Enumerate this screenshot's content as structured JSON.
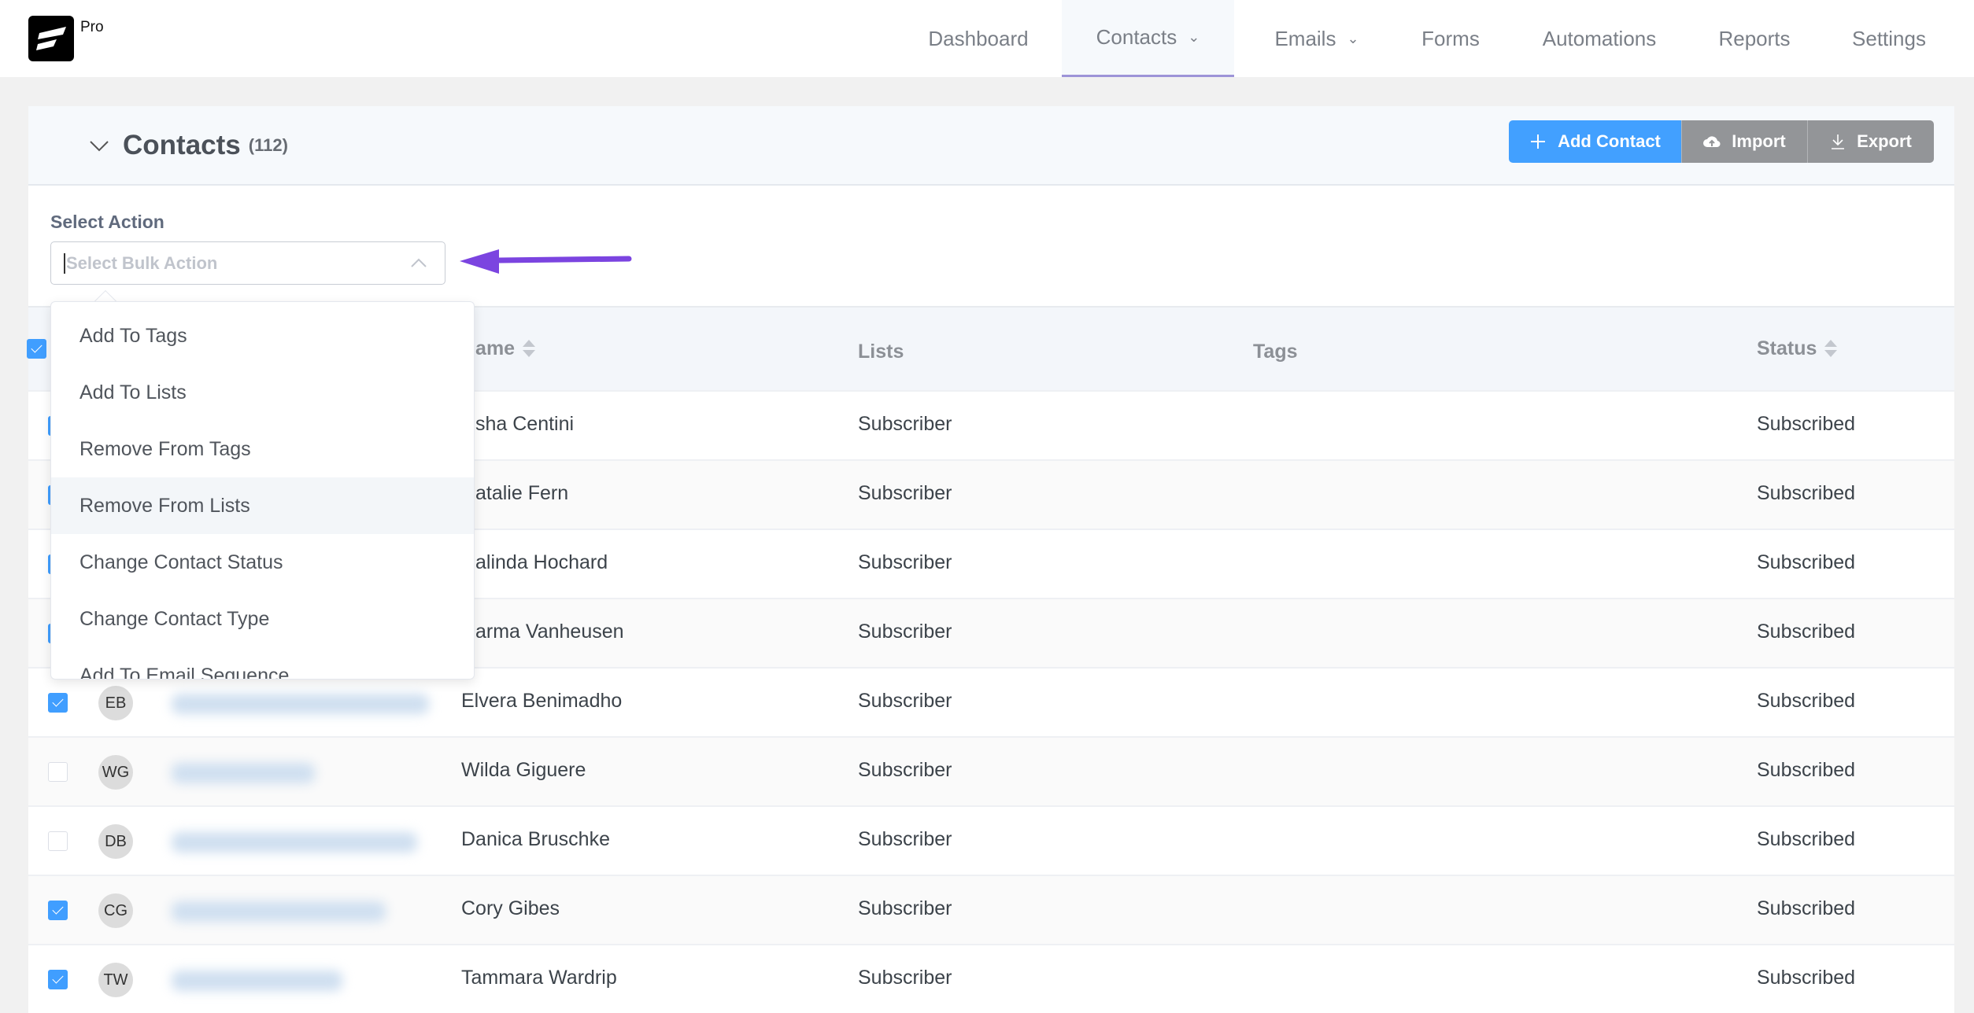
{
  "app": {
    "badge": "Pro",
    "logo_icon": "fluentcrm-logo"
  },
  "nav": [
    {
      "label": "Dashboard"
    },
    {
      "label": "Contacts",
      "has_dropdown": true,
      "active": true
    },
    {
      "label": "Emails",
      "has_dropdown": true
    },
    {
      "label": "Forms"
    },
    {
      "label": "Automations"
    },
    {
      "label": "Reports"
    },
    {
      "label": "Settings"
    }
  ],
  "colors": {
    "primary": "#42a0ff",
    "secondary": "#939598",
    "annotation_arrow": "#7b44e0",
    "active_tab_underline": "#9d94d8"
  },
  "header": {
    "title": "Contacts",
    "count": "(112)",
    "add_label": "Add Contact",
    "import_label": "Import",
    "export_label": "Export"
  },
  "bulk": {
    "label": "Select Action",
    "placeholder": "Select Bulk Action",
    "open": true,
    "options": [
      "Add To Tags",
      "Add To Lists",
      "Remove From Tags",
      "Remove From Lists",
      "Change Contact Status",
      "Change Contact Type",
      "Add To Email Sequence"
    ],
    "hovered": "Remove From Lists"
  },
  "table": {
    "columns": {
      "name": "Name",
      "lists": "Lists",
      "tags": "Tags",
      "status": "Status"
    },
    "header_checked": true,
    "rows": [
      {
        "checked": true,
        "initials": "",
        "name": "sha Centini",
        "list": "Subscriber",
        "tags": "",
        "status": "Subscribed"
      },
      {
        "checked": true,
        "initials": "",
        "name": "atalie Fern",
        "list": "Subscriber",
        "tags": "",
        "status": "Subscribed"
      },
      {
        "checked": true,
        "initials": "",
        "name": "alinda Hochard",
        "list": "Subscriber",
        "tags": "",
        "status": "Subscribed"
      },
      {
        "checked": true,
        "initials": "",
        "name": "arma Vanheusen",
        "list": "Subscriber",
        "tags": "",
        "status": "Subscribed"
      },
      {
        "checked": true,
        "initials": "EB",
        "name": "Elvera Benimadho",
        "list": "Subscriber",
        "tags": "",
        "status": "Subscribed"
      },
      {
        "checked": false,
        "initials": "WG",
        "name": "Wilda Giguere",
        "list": "Subscriber",
        "tags": "",
        "status": "Subscribed"
      },
      {
        "checked": false,
        "initials": "DB",
        "name": "Danica Bruschke",
        "list": "Subscriber",
        "tags": "",
        "status": "Subscribed"
      },
      {
        "checked": true,
        "initials": "CG",
        "name": "Cory Gibes",
        "list": "Subscriber",
        "tags": "",
        "status": "Subscribed"
      },
      {
        "checked": true,
        "initials": "TW",
        "name": "Tammara Wardrip",
        "list": "Subscriber",
        "tags": "",
        "status": "Subscribed"
      }
    ]
  }
}
